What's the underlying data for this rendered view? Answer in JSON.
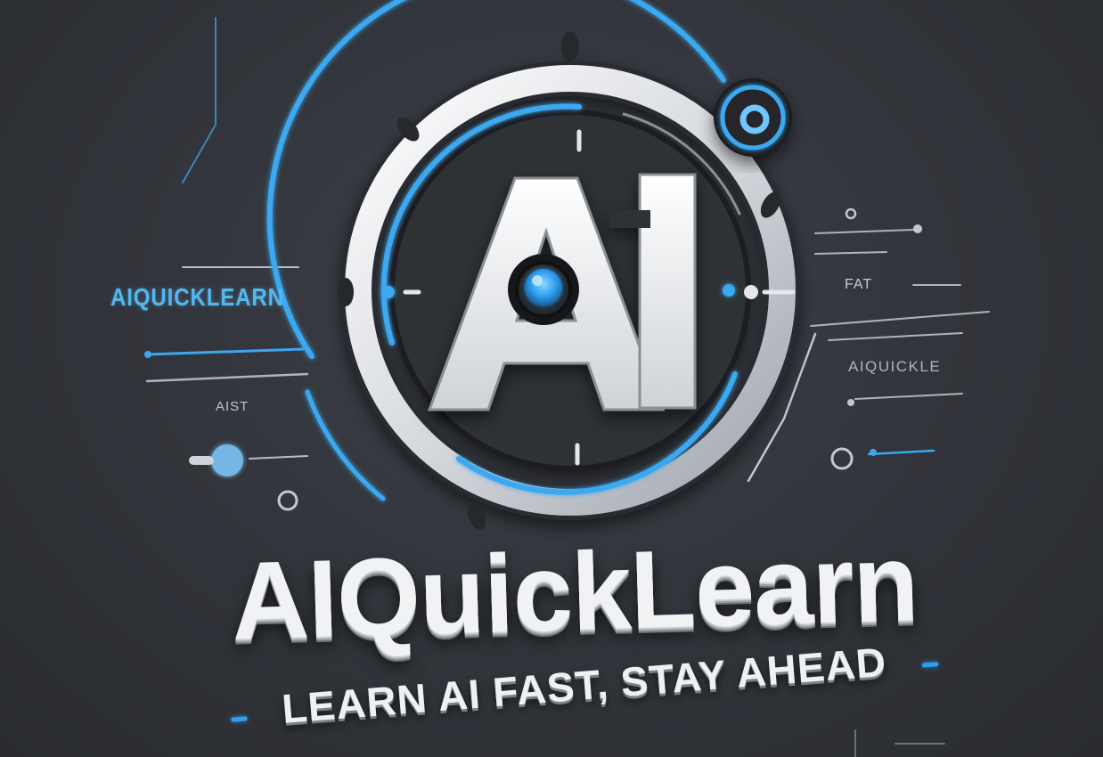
{
  "logo": {
    "emblem_text": "AI",
    "brand_name": "AIQuickLearn",
    "tagline": "LEARN AI FAST, STAY AHEAD"
  },
  "decorative_labels": {
    "left_brand": "AIQUICKLEARN",
    "left_small": "AIST",
    "right_top": "FAT",
    "right_mid": "AIQUICKLE"
  },
  "colors": {
    "background": "#33363c",
    "accent_blue": "#3aa8f0",
    "metal_silver": "#e8eaed"
  }
}
